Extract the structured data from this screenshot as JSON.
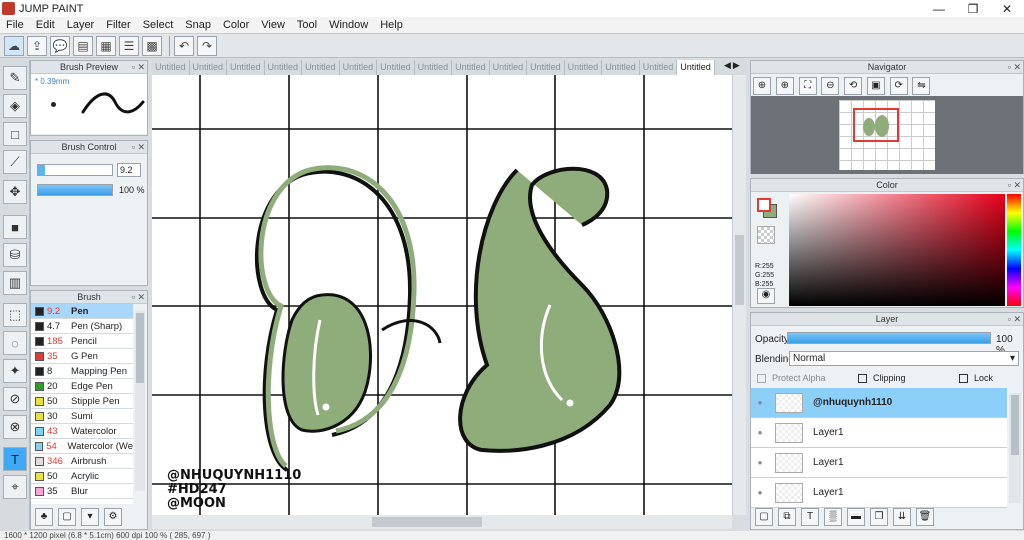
{
  "app": {
    "title": "JUMP PAINT"
  },
  "window_controls": {
    "minimize": "—",
    "maximize": "❐",
    "close": "✕"
  },
  "menu": [
    "File",
    "Edit",
    "Layer",
    "Filter",
    "Select",
    "Snap",
    "Color",
    "View",
    "Tool",
    "Window",
    "Help"
  ],
  "panels": {
    "brush_preview": {
      "title": "Brush Preview",
      "size_label": "* 0.39mm"
    },
    "brush_control": {
      "title": "Brush Control",
      "size_value": "9.2",
      "opacity_value": "100 %",
      "size_fraction": 0.1,
      "opacity_fraction": 1.0
    },
    "brush": {
      "title": "Brush",
      "items": [
        {
          "size": "9.2",
          "name": "Pen",
          "color": "#222222",
          "selected": true
        },
        {
          "size": "4.7",
          "name": "Pen (Sharp)",
          "color": "#222222"
        },
        {
          "size": "185",
          "name": "Pencil",
          "color": "#222222"
        },
        {
          "size": "35",
          "name": "G Pen",
          "color": "#e53935"
        },
        {
          "size": "8",
          "name": "Mapping Pen",
          "color": "#222222"
        },
        {
          "size": "20",
          "name": "Edge Pen",
          "color": "#2e9d2e"
        },
        {
          "size": "50",
          "name": "Stipple Pen",
          "color": "#e8e23a"
        },
        {
          "size": "30",
          "name": "Sumi",
          "color": "#e8e23a"
        },
        {
          "size": "43",
          "name": "Watercolor",
          "color": "#7fd3f0"
        },
        {
          "size": "54",
          "name": "Watercolor (We",
          "color": "#7fd3f0"
        },
        {
          "size": "346",
          "name": "Airbrush",
          "color": "#dddddd"
        },
        {
          "size": "50",
          "name": "Acrylic",
          "color": "#e8e23a"
        },
        {
          "size": "35",
          "name": "Blur",
          "color": "#f4a6d8"
        }
      ]
    },
    "navigator": {
      "title": "Navigator"
    },
    "color": {
      "title": "Color",
      "r": "R:255",
      "g": "G:255",
      "b": "B:255",
      "fg": "#ffffff",
      "bg": "#8fad7b"
    },
    "layer": {
      "title": "Layer",
      "opacity_label": "Opacity",
      "opacity_value": "100 %",
      "opacity_fraction": 1.0,
      "blending_label": "Blending",
      "blending_value": "Normal",
      "protect_alpha": "Protect Alpha",
      "clipping": "Clipping",
      "lock": "Lock",
      "layers": [
        {
          "name": "@nhuquynh1110",
          "selected": true
        },
        {
          "name": "Layer1"
        },
        {
          "name": "Layer1"
        },
        {
          "name": "Layer1"
        }
      ]
    }
  },
  "tabs": [
    "Untitled",
    "Untitled",
    "Untitled",
    "Untitled",
    "Untitled",
    "Untitled",
    "Untitled",
    "Untitled",
    "Untitled",
    "Untitled",
    "Untitled",
    "Untitled",
    "Untitled",
    "Untitled",
    "Untitled"
  ],
  "canvas": {
    "signature_lines": [
      "@NHUQUYNH1110",
      "#HD247",
      "@MOON"
    ],
    "leaf_color": "#8fad7b"
  },
  "statusbar": {
    "text": "1600 * 1200 pixel   (6.8 * 5.1cm)   600 dpi   100 %   ( 285, 697 )"
  }
}
